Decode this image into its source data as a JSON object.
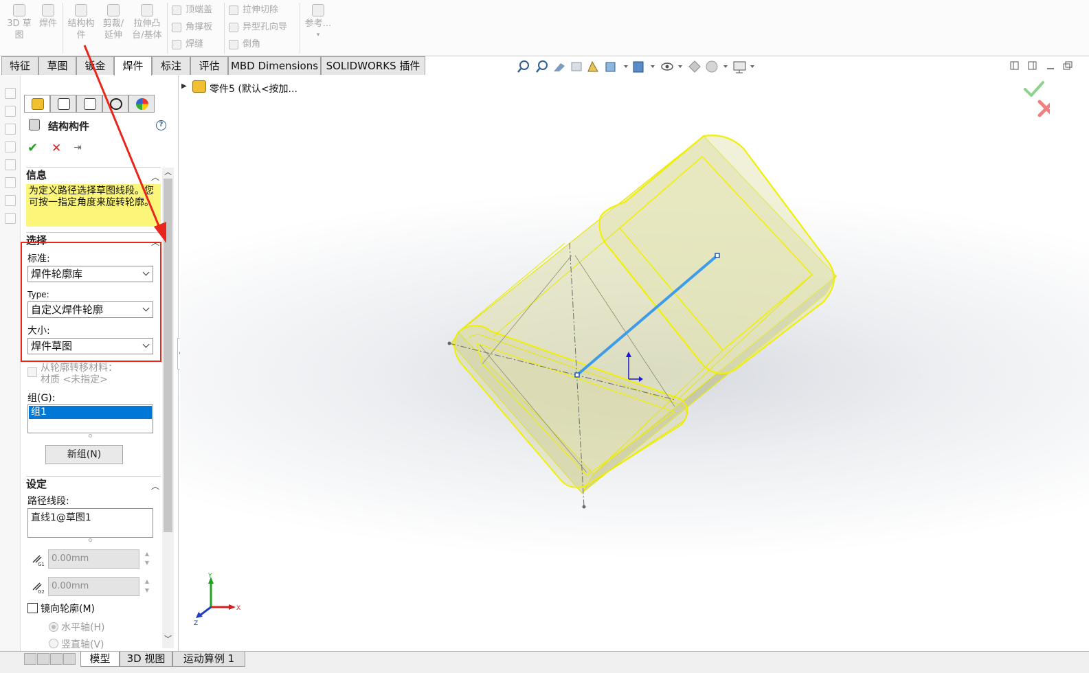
{
  "ribbon": {
    "big_buttons": [
      {
        "label_1": "3D 草",
        "label_2": "图",
        "icon": "sketch-3d-icon"
      },
      {
        "label_1": "焊件",
        "label_2": "",
        "icon": "weldment-icon"
      },
      {
        "label_1": "结构构",
        "label_2": "件",
        "icon": "structural-member-icon"
      },
      {
        "label_1": "剪裁/",
        "label_2": "延伸",
        "icon": "trim-extend-icon"
      },
      {
        "label_1": "拉伸凸",
        "label_2": "台/基体",
        "icon": "extruded-boss-icon"
      },
      {
        "label_1": "参考...",
        "label_2": "",
        "icon": "reference-geometry-icon"
      }
    ],
    "small_buttons": [
      {
        "label": "顶端盖",
        "icon": "end-cap-icon"
      },
      {
        "label": "角撑板",
        "icon": "gusset-icon"
      },
      {
        "label": "焊缝",
        "icon": "weld-bead-icon"
      },
      {
        "label": "拉伸切除",
        "icon": "extruded-cut-icon"
      },
      {
        "label": "异型孔向导",
        "icon": "hole-wizard-icon"
      },
      {
        "label": "倒角",
        "icon": "chamfer-icon"
      }
    ]
  },
  "tabs": [
    {
      "label": "特征"
    },
    {
      "label": "草图"
    },
    {
      "label": "钣金"
    },
    {
      "label": "焊件",
      "active": true
    },
    {
      "label": "标注"
    },
    {
      "label": "评估"
    },
    {
      "label": "MBD Dimensions"
    },
    {
      "label": "SOLIDWORKS 插件"
    }
  ],
  "tree": {
    "part_label": "零件5 (默认<按加..."
  },
  "property_manager": {
    "title": "结构构件",
    "help": "?",
    "ok": "✔",
    "cancel": "✕",
    "pin": "⇥",
    "info": {
      "heading": "信息",
      "message": "为定义路径选择草图线段。您可按一指定角度来旋转轮廓。"
    },
    "selection": {
      "heading": "选择",
      "standard_label": "标准:",
      "standard_value": "焊件轮廓库",
      "type_label": "Type:",
      "type_value": "自定义焊件轮廓",
      "size_label": "大小:",
      "size_value": "焊件草图",
      "transfer_label": "从轮廓转移材料：",
      "material_label": "材质 <未指定>",
      "group_label": "组(G):",
      "groups": [
        "组1"
      ],
      "new_group_button": "新组(N)"
    },
    "settings": {
      "heading": "设定",
      "path_label": "路径线段:",
      "path_items": [
        "直线1@草图1"
      ],
      "angle1_value": "0.00mm",
      "angle1_icon_label": "G1",
      "angle2_value": "0.00mm",
      "angle2_icon_label": "G2",
      "mirror_label": "镜向轮廓(M)",
      "horizontal_axis_label": "水平轴(H)",
      "vertical_axis_label": "竖直轴(V)"
    }
  },
  "viewport": {
    "triad": {
      "x": "X",
      "y": "Y",
      "z": "Z"
    },
    "accept_color": "#8fd18f",
    "reject_color": "#f08080",
    "profile_color": "#f0f000",
    "path_color": "#3d9be9"
  },
  "bottom_tabs": [
    {
      "label": "模型",
      "active": true
    },
    {
      "label": "3D 视图"
    },
    {
      "label": "运动算例 1"
    }
  ],
  "annotation": {
    "color": "#e8261d"
  }
}
